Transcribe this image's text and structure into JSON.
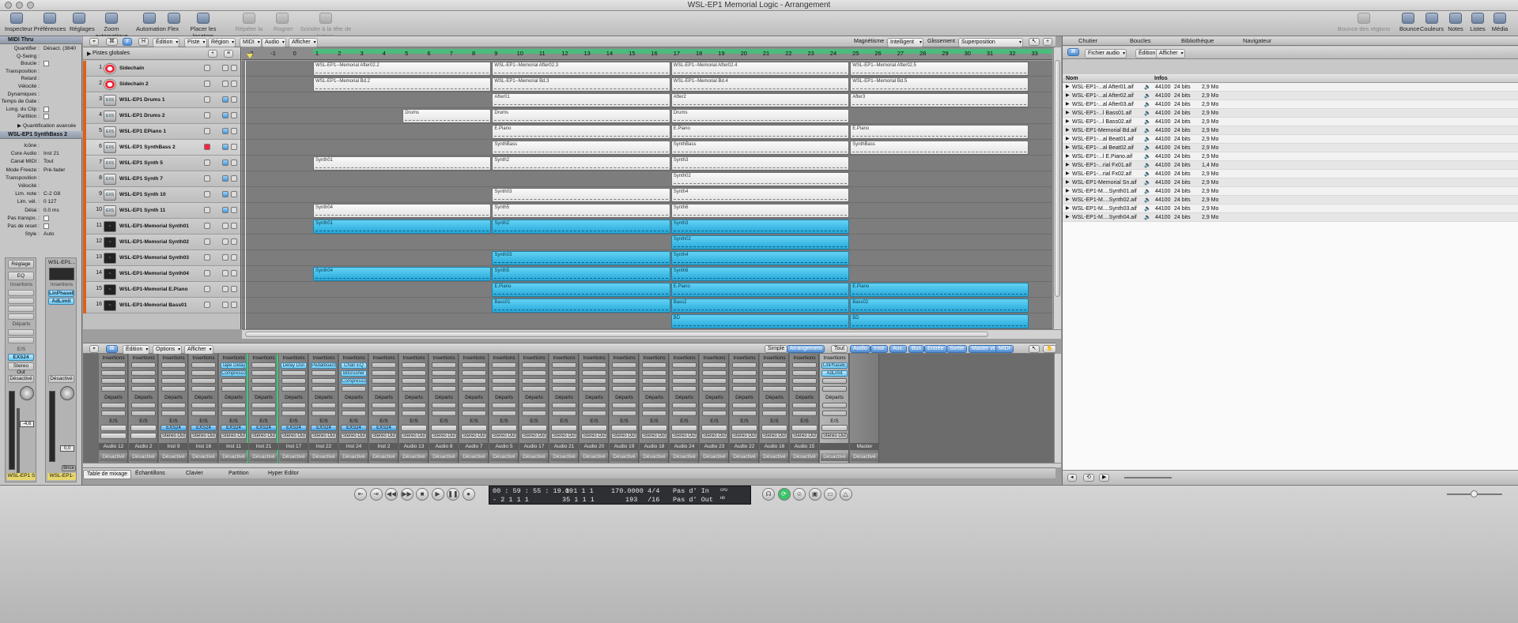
{
  "window": {
    "title": "WSL-EP1 Memorial Logic - Arrangement"
  },
  "toolbar": {
    "left": [
      "Inspecteur",
      "Préférences",
      "Réglages",
      "Zoom automatique",
      "Automation",
      "Flex",
      "Placer les locators",
      "Répéter la section",
      "Rogner",
      "Scinder à la tête de lecture"
    ],
    "right": [
      "Bounce des régions",
      "Bounce",
      "Couleurs",
      "Notes",
      "Listes",
      "Média"
    ]
  },
  "inspector": {
    "midi_thru": "MIDI Thru",
    "rows": [
      [
        "Quantifier :",
        "Désact. (3840"
      ],
      [
        "Q-Swing :",
        ""
      ],
      [
        "Boucle :",
        ""
      ],
      [
        "Transposition :",
        ""
      ],
      [
        "Retard :",
        ""
      ],
      [
        "Vélocité :",
        ""
      ],
      [
        "Dynamiques :",
        ""
      ],
      [
        "Temps de Gate :",
        ""
      ],
      [
        "Long. du Clip :",
        ""
      ],
      [
        "Partition :",
        ""
      ]
    ],
    "quant_avancee": "Quantification avancée",
    "track_header": "WSL-EP1 SynthBass 2",
    "track_rows": [
      [
        "Icône :",
        ""
      ],
      [
        "Core Audio :",
        "Inst 21"
      ],
      [
        "Canal MIDI :",
        "Tout"
      ],
      [
        "Mode Freeze :",
        "Pré-fader"
      ],
      [
        "Transposition :",
        ""
      ],
      [
        "Vélocité :",
        ""
      ],
      [
        "Lim. note :",
        "C-2   G8"
      ],
      [
        "Lim. vél. :",
        "0      127"
      ],
      [
        "Délai :",
        "0.0 ms"
      ],
      [
        "Pas transpo. :",
        ""
      ],
      [
        "Pas de reset :",
        ""
      ],
      [
        "Style :",
        "Auto"
      ]
    ],
    "strip1": {
      "reglage": "Réglage",
      "eq": "EQ",
      "insertions": "Insertions",
      "departs": "Départs",
      "es": "E/S",
      "plugin": "EXS24",
      "out": "Stereo Out",
      "desact": "Désactivé",
      "value": "-4,6",
      "name": "WSL-EP1 S"
    },
    "strip2": {
      "title": "WSL-EP1...",
      "insertions": "Insertions",
      "plugins": [
        "LinPhaseE",
        "AdLimit"
      ],
      "desact": "Désactivé",
      "value": "0,0",
      "bnce": "Bnce",
      "name": "WSL-EP1-"
    }
  },
  "arrange": {
    "menus": [
      "Édition",
      "Piste",
      "Région",
      "MIDI",
      "Audio",
      "Afficher"
    ],
    "magnetisme_label": "Magnétisme :",
    "magnetisme": "Intelligent",
    "glissement_label": "Glissement :",
    "glissement": "Superposition",
    "global": "Pistes globales",
    "ruler": [
      "-2",
      "-1",
      "0",
      "1",
      "2",
      "3",
      "4",
      "5",
      "6",
      "7",
      "8",
      "9",
      "10",
      "11",
      "12",
      "13",
      "14",
      "15",
      "16",
      "17",
      "18",
      "19",
      "20",
      "21",
      "22",
      "23",
      "24",
      "25",
      "26",
      "27",
      "28",
      "29",
      "30",
      "31",
      "32",
      "33"
    ]
  },
  "tracks": [
    {
      "num": "1",
      "name": "Sidechain",
      "icon": "red"
    },
    {
      "num": "2",
      "name": "Sidechain 2",
      "icon": "red"
    },
    {
      "num": "3",
      "name": "WSL-EP1 Drums 1",
      "icon": "exs"
    },
    {
      "num": "4",
      "name": "WSL-EP1 Drums 2",
      "icon": "exs"
    },
    {
      "num": "5",
      "name": "WSL-EP1 EPiano 1",
      "icon": "exs"
    },
    {
      "num": "6",
      "name": "WSL-EP1 SynthBass 2",
      "icon": "exs"
    },
    {
      "num": "7",
      "name": "WSL-EP1 Synth 5",
      "icon": "exs"
    },
    {
      "num": "8",
      "name": "WSL-EP1 Synth 7",
      "icon": "exs"
    },
    {
      "num": "9",
      "name": "WSL-EP1 Synth 10",
      "icon": "exs"
    },
    {
      "num": "10",
      "name": "WSL-EP1 Synth 11",
      "icon": "exs"
    },
    {
      "num": "11",
      "name": "WSL-EP1-Memorial Synth01",
      "icon": "aud"
    },
    {
      "num": "12",
      "name": "WSL-EP1-Memorial Synth02",
      "icon": "aud"
    },
    {
      "num": "13",
      "name": "WSL-EP1-Memorial Synth03",
      "icon": "aud"
    },
    {
      "num": "14",
      "name": "WSL-EP1-Memorial Synth04",
      "icon": "aud"
    },
    {
      "num": "15",
      "name": "WSL-EP1-Memorial E.Piano",
      "icon": "aud"
    },
    {
      "num": "16",
      "name": "WSL-EP1-Memorial Bass01",
      "icon": "aud"
    }
  ],
  "regions": [
    {
      "lane": 0,
      "start": 1,
      "end": 9,
      "name": "WSL-EP1--Memorial After02.2",
      "c": "w"
    },
    {
      "lane": 0,
      "start": 9,
      "end": 17,
      "name": "WSL-EP1--Memorial After02.3",
      "c": "w"
    },
    {
      "lane": 0,
      "start": 17,
      "end": 25,
      "name": "WSL-EP1--Memorial After02.4",
      "c": "w"
    },
    {
      "lane": 0,
      "start": 25,
      "end": 33,
      "name": "WSL-EP1--Memorial After02.5",
      "c": "w"
    },
    {
      "lane": 1,
      "start": 1,
      "end": 9,
      "name": "WSL-EP1--Memorial Bd.2",
      "c": "w"
    },
    {
      "lane": 1,
      "start": 9,
      "end": 17,
      "name": "WSL-EP1--Memorial Bd.3",
      "c": "w"
    },
    {
      "lane": 1,
      "start": 17,
      "end": 25,
      "name": "WSL-EP1--Memorial Bd.4",
      "c": "w"
    },
    {
      "lane": 1,
      "start": 25,
      "end": 33,
      "name": "WSL-EP1--Memorial Bd.5",
      "c": "w"
    },
    {
      "lane": 2,
      "start": 9,
      "end": 17,
      "name": "After01",
      "c": "w"
    },
    {
      "lane": 2,
      "start": 17,
      "end": 25,
      "name": "After2",
      "c": "w"
    },
    {
      "lane": 2,
      "start": 25,
      "end": 33,
      "name": "After3",
      "c": "w"
    },
    {
      "lane": 3,
      "start": 5,
      "end": 9,
      "name": "Drums",
      "c": "w"
    },
    {
      "lane": 3,
      "start": 9,
      "end": 17,
      "name": "Drums",
      "c": "w"
    },
    {
      "lane": 3,
      "start": 17,
      "end": 25,
      "name": "Drums",
      "c": "w"
    },
    {
      "lane": 4,
      "start": 9,
      "end": 17,
      "name": "E.Piano",
      "c": "w"
    },
    {
      "lane": 4,
      "start": 17,
      "end": 25,
      "name": "E.Piano",
      "c": "w"
    },
    {
      "lane": 4,
      "start": 25,
      "end": 33,
      "name": "E.Piano",
      "c": "w"
    },
    {
      "lane": 5,
      "start": 9,
      "end": 17,
      "name": "SynthBass",
      "c": "w"
    },
    {
      "lane": 5,
      "start": 17,
      "end": 25,
      "name": "SynthBass",
      "c": "w"
    },
    {
      "lane": 5,
      "start": 25,
      "end": 33,
      "name": "SynthBass",
      "c": "w"
    },
    {
      "lane": 6,
      "start": 1,
      "end": 9,
      "name": "Synth01",
      "c": "w"
    },
    {
      "lane": 6,
      "start": 9,
      "end": 17,
      "name": "Synth2",
      "c": "w"
    },
    {
      "lane": 6,
      "start": 17,
      "end": 25,
      "name": "Synth3",
      "c": "w"
    },
    {
      "lane": 7,
      "start": 17,
      "end": 25,
      "name": "Synth02",
      "c": "w"
    },
    {
      "lane": 8,
      "start": 9,
      "end": 17,
      "name": "Synth03",
      "c": "w"
    },
    {
      "lane": 8,
      "start": 17,
      "end": 25,
      "name": "Synth4",
      "c": "w"
    },
    {
      "lane": 9,
      "start": 1,
      "end": 9,
      "name": "Synth04",
      "c": "w"
    },
    {
      "lane": 9,
      "start": 9,
      "end": 17,
      "name": "Synth5",
      "c": "w"
    },
    {
      "lane": 9,
      "start": 17,
      "end": 25,
      "name": "Synth6",
      "c": "w"
    },
    {
      "lane": 10,
      "start": 1,
      "end": 9,
      "name": "Synth01",
      "c": "b"
    },
    {
      "lane": 10,
      "start": 9,
      "end": 17,
      "name": "Synth2",
      "c": "b"
    },
    {
      "lane": 10,
      "start": 17,
      "end": 25,
      "name": "Synth3",
      "c": "b"
    },
    {
      "lane": 11,
      "start": 17,
      "end": 25,
      "name": "Synth02",
      "c": "b"
    },
    {
      "lane": 12,
      "start": 9,
      "end": 17,
      "name": "Synth03",
      "c": "b"
    },
    {
      "lane": 12,
      "start": 17,
      "end": 25,
      "name": "Synth4",
      "c": "b"
    },
    {
      "lane": 13,
      "start": 1,
      "end": 9,
      "name": "Synth04",
      "c": "b"
    },
    {
      "lane": 13,
      "start": 9,
      "end": 17,
      "name": "Synth5",
      "c": "b"
    },
    {
      "lane": 13,
      "start": 17,
      "end": 25,
      "name": "Synth6",
      "c": "b"
    },
    {
      "lane": 14,
      "start": 9,
      "end": 17,
      "name": "E.Piano",
      "c": "b"
    },
    {
      "lane": 14,
      "start": 17,
      "end": 25,
      "name": "E.Piano",
      "c": "b"
    },
    {
      "lane": 14,
      "start": 25,
      "end": 33,
      "name": "E.Piano",
      "c": "b"
    },
    {
      "lane": 15,
      "start": 9,
      "end": 17,
      "name": "Bass01",
      "c": "b"
    },
    {
      "lane": 15,
      "start": 17,
      "end": 25,
      "name": "Bass2",
      "c": "b"
    },
    {
      "lane": 15,
      "start": 25,
      "end": 33,
      "name": "Bass02",
      "c": "b"
    },
    {
      "lane": 16,
      "start": 17,
      "end": 25,
      "name": "BD",
      "c": "b"
    },
    {
      "lane": 16,
      "start": 25,
      "end": 33,
      "name": "BD",
      "c": "b"
    }
  ],
  "mixer": {
    "menus": [
      "Édition",
      "Options",
      "Afficher"
    ],
    "views": [
      "Simple",
      "Arrangement",
      "Tout"
    ],
    "filters": [
      "Audio",
      "Instr",
      "Aux.",
      "Bus",
      "Entrée",
      "Sortie",
      "Master vol.",
      "MIDI"
    ],
    "insertions": "Insertions",
    "departs": "Départs",
    "es": "E/S",
    "desact": "Désactivé",
    "channels": [
      {
        "name": "Audio 12",
        "inst": "",
        "plugins": [],
        "out": ""
      },
      {
        "name": "Audio 2",
        "inst": "",
        "plugins": [],
        "out": ""
      },
      {
        "name": "Inst 9",
        "inst": "EXS24",
        "plugins": [],
        "out": "Stereo Out"
      },
      {
        "name": "Inst 16",
        "inst": "EXS24",
        "plugins": [],
        "out": "Stereo Out"
      },
      {
        "name": "Inst 11",
        "inst": "EXS24",
        "plugins": [
          "Tape Delay",
          "Compresso"
        ],
        "out": "Stereo Out",
        "green": true
      },
      {
        "name": "Inst 21",
        "inst": "EXS24",
        "plugins": [],
        "out": "Stereo Out",
        "green": true
      },
      {
        "name": "Inst 17",
        "inst": "EXS24",
        "plugins": [
          "Delay Dsn"
        ],
        "out": "Stereo Out"
      },
      {
        "name": "Inst 22",
        "inst": "EXS24",
        "plugins": [
          "Pedalboard"
        ],
        "out": "Stereo Out"
      },
      {
        "name": "Inst 24",
        "inst": "EXS24",
        "plugins": [
          "Chan EQ",
          "Bitcrusher",
          "Compresso"
        ],
        "out": "Stereo Out"
      },
      {
        "name": "Inst 2",
        "inst": "EXS24",
        "plugins": [],
        "out": "Stereo Out"
      },
      {
        "name": "Audio 13",
        "inst": "",
        "plugins": [],
        "out": "Stereo Out"
      },
      {
        "name": "Audio 8",
        "inst": "",
        "plugins": [],
        "out": "Stereo Out"
      },
      {
        "name": "Audio 7",
        "inst": "",
        "plugins": [],
        "out": "Stereo Out"
      },
      {
        "name": "Audio 5",
        "inst": "",
        "plugins": [],
        "out": "Stereo Out"
      },
      {
        "name": "Audio 17",
        "inst": "",
        "plugins": [],
        "out": "Stereo Out"
      },
      {
        "name": "Audio 21",
        "inst": "",
        "plugins": [],
        "out": "Stereo Out"
      },
      {
        "name": "Audio 20",
        "inst": "",
        "plugins": [],
        "out": "Stereo Out"
      },
      {
        "name": "Audio 19",
        "inst": "",
        "plugins": [],
        "out": "Stereo Out"
      },
      {
        "name": "Audio 18",
        "inst": "",
        "plugins": [],
        "out": "Stereo Out"
      },
      {
        "name": "Audio 24",
        "inst": "",
        "plugins": [],
        "out": "Stereo Out"
      },
      {
        "name": "Audio 23",
        "inst": "",
        "plugins": [],
        "out": "Stereo Out"
      },
      {
        "name": "Audio 22",
        "inst": "",
        "plugins": [],
        "out": "Stereo Out"
      },
      {
        "name": "Audio 16",
        "inst": "",
        "plugins": [],
        "out": "Stereo Out"
      },
      {
        "name": "Audio 15",
        "inst": "",
        "plugins": [],
        "out": "Stereo Out"
      },
      {
        "name": "",
        "inst": "",
        "plugins": [
          "LinPhaseE",
          "AdLimit"
        ],
        "out": "Stereo Out",
        "stereo": true
      },
      {
        "name": "Master",
        "inst": "",
        "plugins": [],
        "out": "",
        "master": true
      }
    ]
  },
  "bottom_tabs": [
    "Table de mixage",
    "Échantillons",
    "Clavier",
    "Partition",
    "Hyper Editor"
  ],
  "browser": {
    "tabs": [
      "Chutier",
      "Boucles",
      "Bibliothèque",
      "Navigateur"
    ],
    "menus": [
      "Fichier audio",
      "Édition",
      "Afficher"
    ],
    "col_name": "Nom",
    "col_info": "Infos",
    "files": [
      "WSL-EP1-...al After01.aif",
      "WSL-EP1-...al After02.aif",
      "WSL-EP1-...al After03.aif",
      "WSL-EP1-...l Bass01.aif",
      "WSL-EP1-...l Bass02.aif",
      "WSL-EP1-Memorial Bd.aif",
      "WSL-EP1-...al Beat01.aif",
      "WSL-EP1-...al Beat02.aif",
      "WSL-EP1-...l E.Piano.aif",
      "WSL-EP1-...rial Fx01.aif",
      "WSL-EP1-...rial Fx02.aif",
      "WSL-EP1-Memorial Sn.aif",
      "WSL-EP1-M....Synth01.aif",
      "WSL-EP1-M....Synth02.aif",
      "WSL-EP1-M....Synth03.aif",
      "WSL-EP1-M....Synth04.aif"
    ],
    "rate": "44100",
    "bits": "24 bits",
    "sizes": [
      "2,9 Mo",
      "2,9 Mo",
      "2,9 Mo",
      "2,9 Mo",
      "2,9 Mo",
      "2,9 Mo",
      "2,9 Mo",
      "2,9 Mo",
      "2,9 Mo",
      "1,4 Mo",
      "2,9 Mo",
      "2,9 Mo",
      "2,9 Mo",
      "2,9 Mo",
      "2,9 Mo",
      "2,9 Mo"
    ]
  },
  "transport": {
    "time": "00 : 59 : 55 : 19.09",
    "time2": "-   2   1   1     1",
    "bars": "1    1    1     1",
    "bars2": "35   1    1     1",
    "tempo": "170.0000",
    "tempo2": "193",
    "sig": "4/4",
    "sig2": "/16",
    "in": "Pas d' In",
    "out": "Pas d' Out",
    "cpu": "CPU",
    "hd": "HD"
  },
  "colors": {
    "accent_blue": "#26a9dc",
    "cycle_green": "#4bbc7c",
    "track_strip": "#e15f1a"
  }
}
